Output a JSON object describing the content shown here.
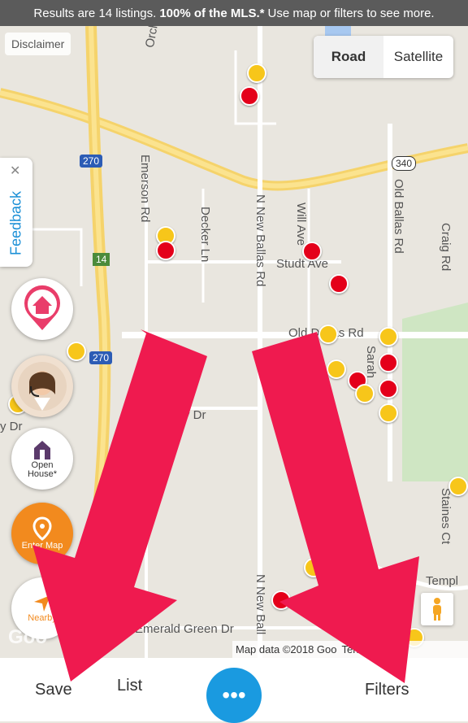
{
  "banner": {
    "prefix": "Results are 14 listings.",
    "bold": "100% of the MLS.*",
    "suffix": "Use map or filters to see more."
  },
  "map": {
    "disclaimer": "Disclaimer",
    "map_type": {
      "road": "Road",
      "satellite": "Satellite"
    },
    "feedback": "Feedback",
    "labels": {
      "orchard": "Orchard La",
      "emerson": "Emerson Rd",
      "decker": "Decker Ln",
      "n_new_ballas": "N New Ballas Rd",
      "will_ave": "Will Ave",
      "old_ballas": "Old Ballas Rd",
      "craig": "Craig Rd",
      "studt": "Studt Ave",
      "old_dallas": "Old Dallas Rd",
      "sarah": "Sarah",
      "dr": "y Dr",
      "dr2": "y Dr",
      "staines": "Staines Ct",
      "temple": "Templ",
      "emerald": "Emerald Green Dr",
      "n_new_ball2": "N New Ball",
      "hwy270a": "270",
      "hwy270b": "270",
      "hwy340": "340",
      "hwy14": "14"
    },
    "attribution": {
      "data": "Map data ©2018 Goo",
      "terms": "Terms of Use"
    },
    "google": "Goo"
  },
  "side_buttons": {
    "open_house": "Open House*",
    "enter_map": "Enter Map",
    "nearby": "Nearby"
  },
  "bottom": {
    "save": "Save",
    "list": "List",
    "menu": "•••",
    "filters": "Filters"
  },
  "colors": {
    "accent": "#1a9ae0",
    "arrow": "#ef1a4f",
    "pin_yellow": "#f7c61a",
    "pin_red": "#e4001a"
  }
}
